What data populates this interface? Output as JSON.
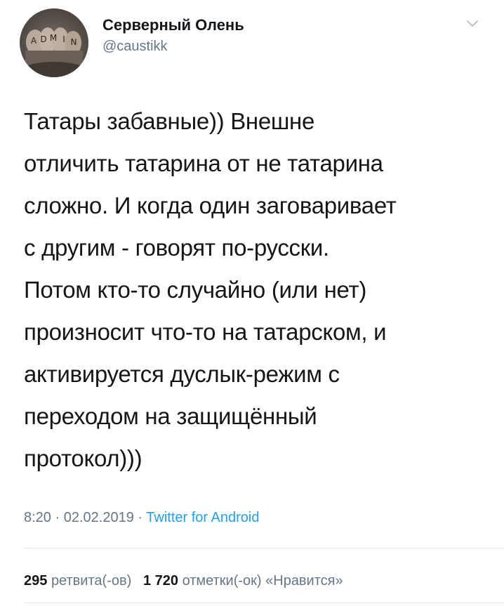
{
  "author": {
    "display_name": "Серверный Олень",
    "handle": "@caustikk",
    "avatar_icon": "avatar-fist-tattoo",
    "avatar_tattoo_text": "ADMIN"
  },
  "menu": {
    "icon": "chevron-down-icon"
  },
  "tweet": {
    "lines": [
      "Татары забавные)) Внешне",
      "отличить татарина от не татарина",
      "сложно. И когда один заговаривает",
      "с другим - говорят по-русски.",
      "Потом кто-то случайно (или нет)",
      "произносит что-то на татарском, и",
      "активируется дуслык-режим с",
      "переходом на защищённый",
      "протокол)))"
    ]
  },
  "meta": {
    "time": "8:20",
    "separator": "·",
    "date": "02.02.2019",
    "source": "Twitter for Android"
  },
  "stats": {
    "retweets_count": "295",
    "retweets_label": "ретвита(-ов)",
    "likes_count": "1 720",
    "likes_label": "отметки(-ок) «Нравится»"
  },
  "colors": {
    "text": "#14171a",
    "secondary": "#657786",
    "link": "#1da1f2",
    "divider": "#e1e8ed"
  }
}
